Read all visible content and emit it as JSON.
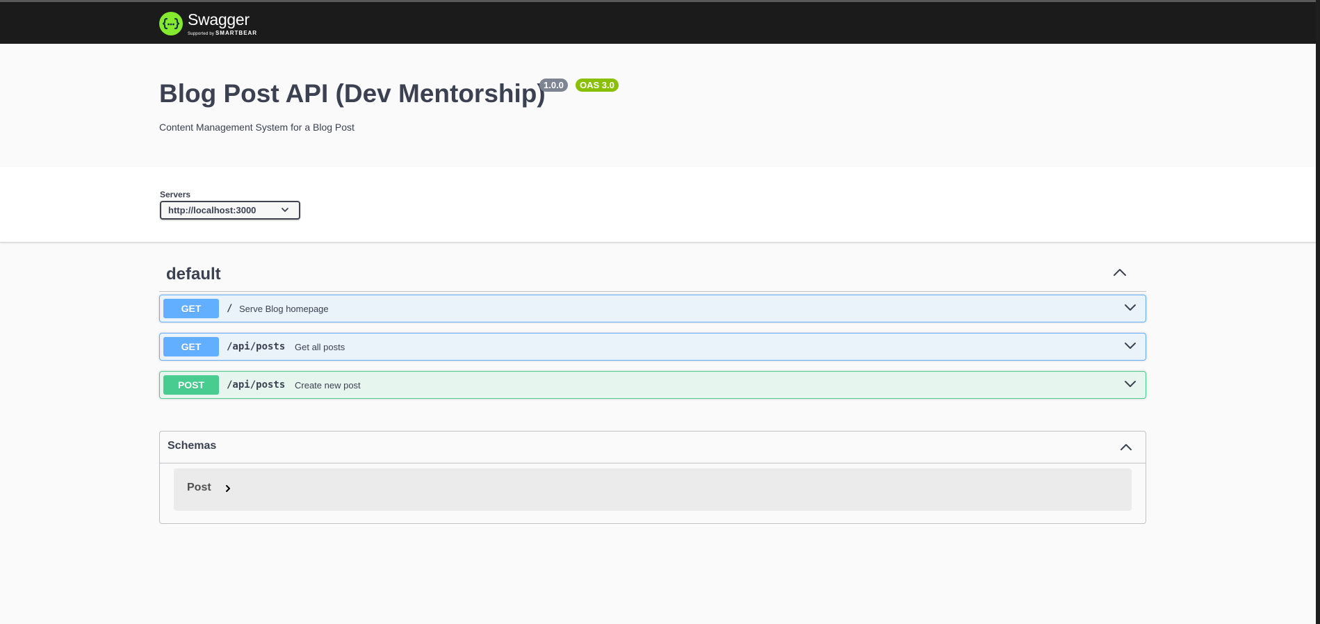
{
  "topbar": {
    "logo_name": "Swagger",
    "logo_sub_prefix": "Supported by",
    "logo_sub_brand": "SMARTBEAR",
    "logo_glyph": "{···}"
  },
  "info": {
    "title": "Blog Post API (Dev Mentorship)",
    "version": "1.0.0",
    "oas": "OAS 3.0",
    "description": "Content Management System for a Blog Post"
  },
  "servers": {
    "label": "Servers",
    "selected": "http://localhost:3000"
  },
  "tag": {
    "name": "default"
  },
  "operations": [
    {
      "method": "GET",
      "path": "/",
      "summary": "Serve Blog homepage"
    },
    {
      "method": "GET",
      "path": "/api/posts",
      "summary": "Get all posts"
    },
    {
      "method": "POST",
      "path": "/api/posts",
      "summary": "Create new post"
    }
  ],
  "schemas": {
    "title": "Schemas",
    "models": [
      {
        "name": "Post"
      }
    ]
  },
  "colors": {
    "topbar": "#1b1b1b",
    "logo_green": "#85ea2d",
    "get": "#61affe",
    "post": "#49cc90",
    "version_badge": "#7d8492",
    "oas_badge": "#89bf04"
  }
}
